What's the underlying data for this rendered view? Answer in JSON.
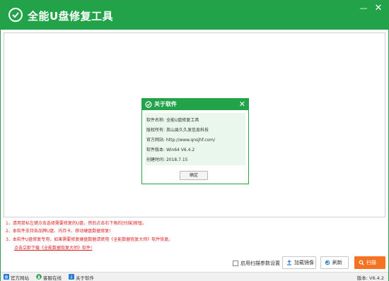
{
  "app": {
    "title": "全能U盘修复工具"
  },
  "about_dialog": {
    "title": "关于软件",
    "rows": [
      {
        "label": "软件名称:",
        "value": "全能U盘修复工具"
      },
      {
        "label": "版权所有:",
        "value": "英山县久久发信息科技"
      },
      {
        "label": "官方网站:",
        "value": "http://www.qnsjhf.com/"
      },
      {
        "label": "软件版本:",
        "value": "Win64 V6.4.2"
      },
      {
        "label": "创建时间:",
        "value": "2018.7.15"
      }
    ],
    "ok_label": "确定"
  },
  "instructions": [
    "1、请用鼠标左键点击选择需要修复的U盘，然后点击右下角的[扫描]按钮。",
    "2、本软件支持各品牌U盘、内存卡、移动硬盘数据修复!",
    "3、本软件U盘修复专用，如果需要修复硬盘数据请使用《全能数据恢复大师》软件恢复。",
    "点击立即下载《全能数据恢复大师》软件!"
  ],
  "controls": {
    "scan_settings_label": "启用扫描参数设置",
    "load_image_label": "加载镜像",
    "refresh_label": "刷新",
    "scan_label": "扫描"
  },
  "statusbar": {
    "items": [
      "官方网站",
      "客服在线",
      "关于软件"
    ],
    "version": "版本: V6.4.2"
  },
  "colors": {
    "brand_green": "#22a34a",
    "accent_orange": "#f37321",
    "warning_red": "#e02020"
  }
}
